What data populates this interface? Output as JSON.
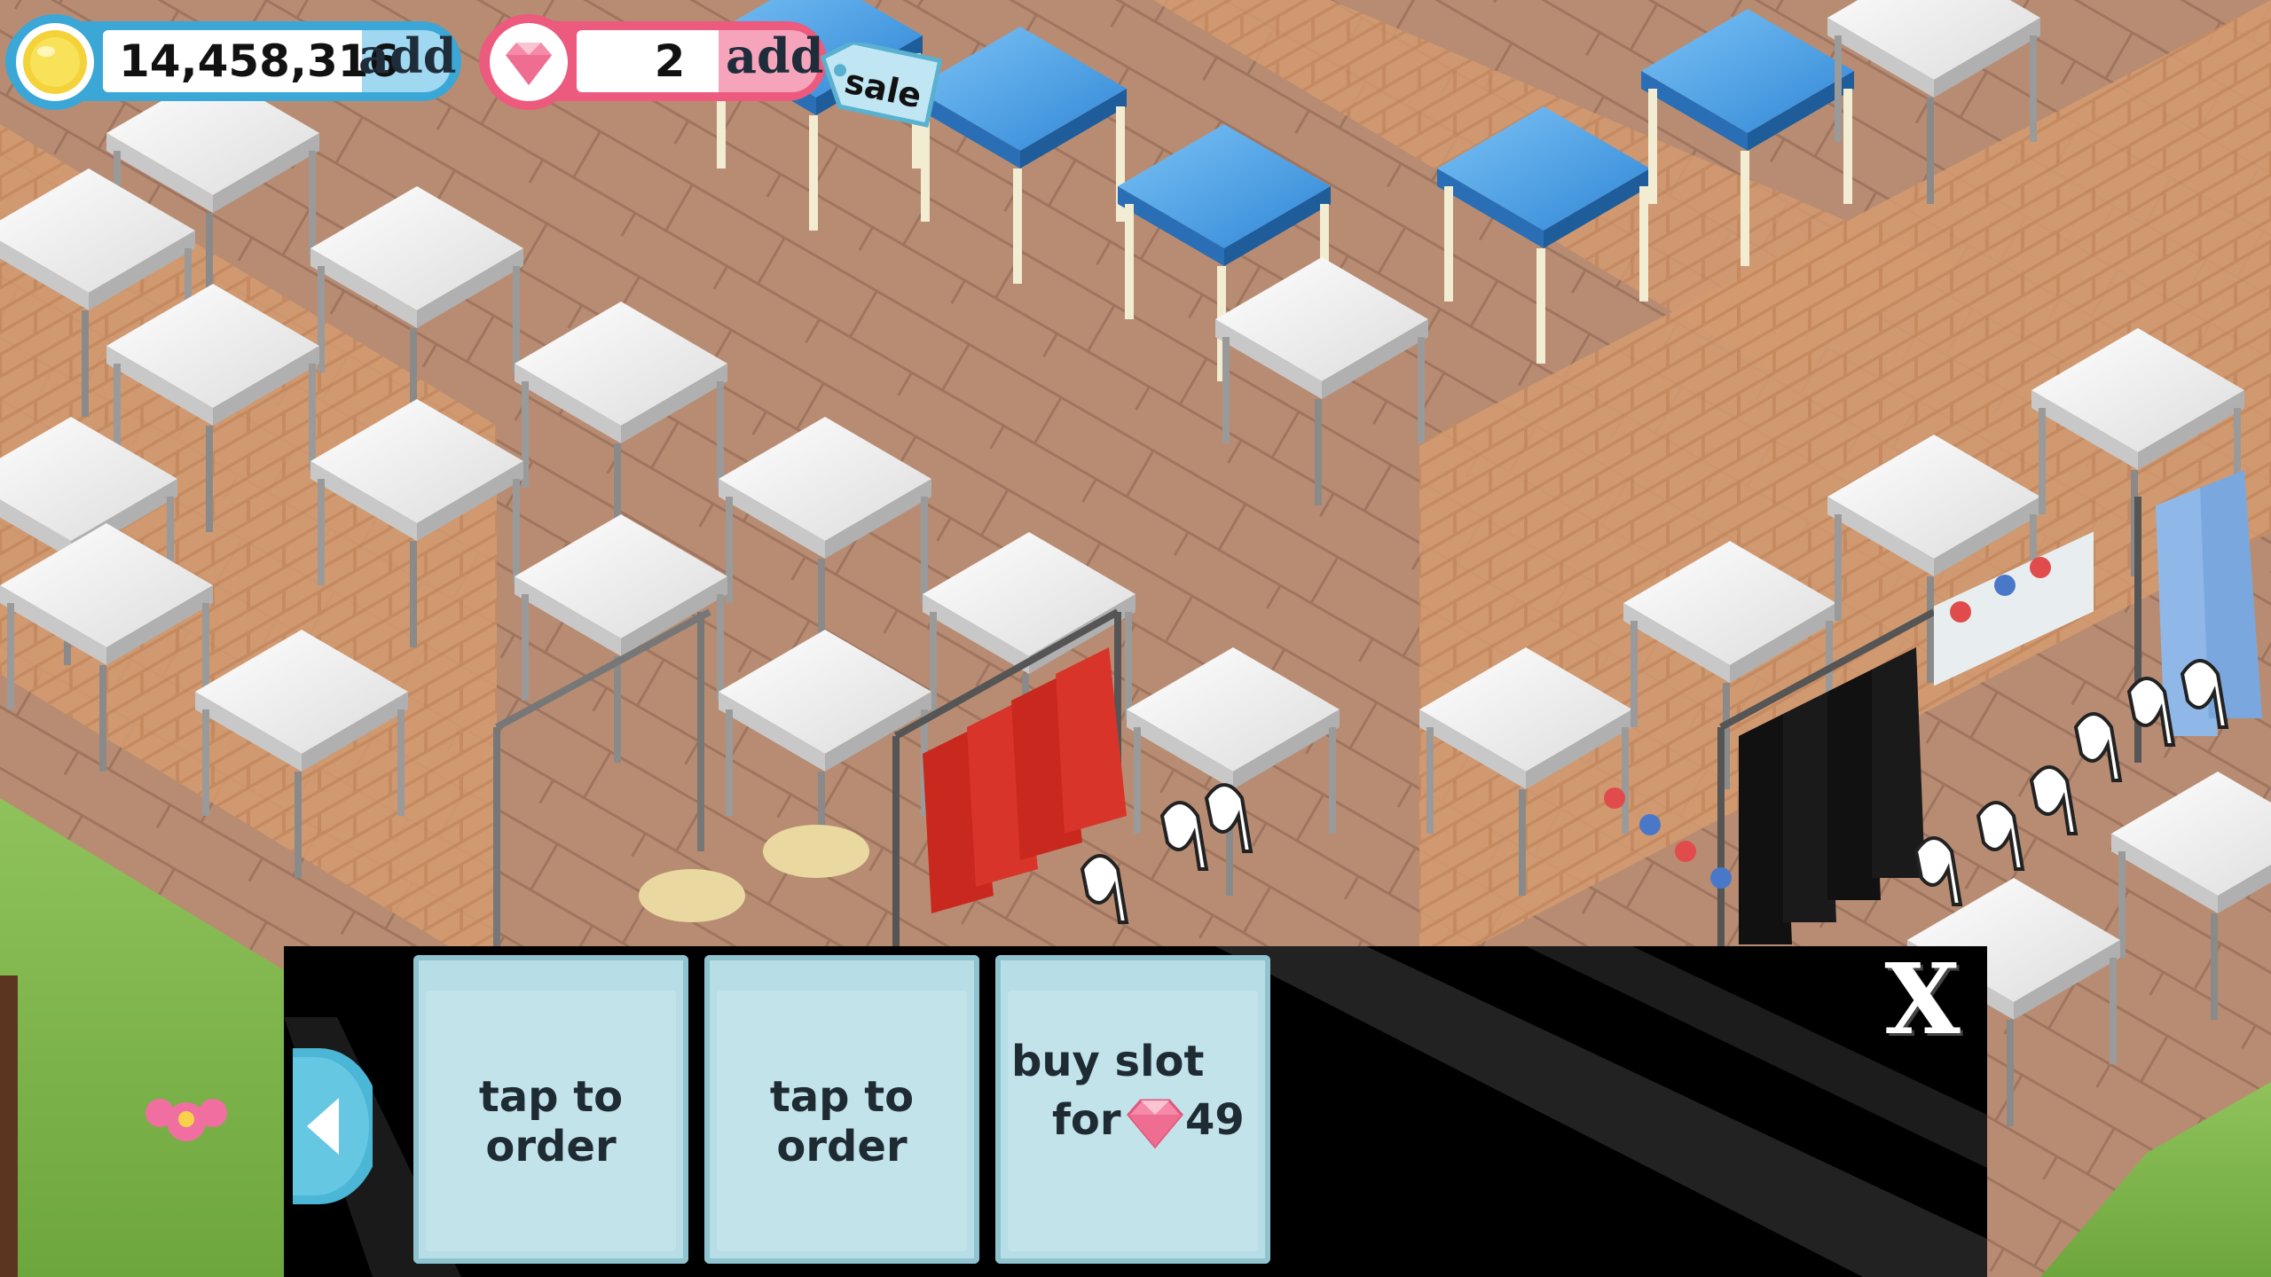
{
  "hud": {
    "coins": {
      "value": "14,458,316",
      "add_label": "add",
      "icon": "gold-coin-icon"
    },
    "gems": {
      "value": "2",
      "add_label": "add",
      "icon": "diamond-gem-icon"
    },
    "sale_tag": {
      "label": "sale"
    }
  },
  "order_panel": {
    "slots": [
      {
        "label": "tap to order"
      },
      {
        "label": "tap to order"
      },
      {
        "buy_text": "buy slot",
        "for_text": "for",
        "price": "49",
        "currency_icon": "diamond-gem-icon"
      }
    ],
    "close_label": "X",
    "prev_icon": "left-arrow-icon"
  },
  "colors": {
    "coin_accent": "#3aa7d6",
    "gem_accent": "#ec5a7e",
    "panel_bg": "#000000",
    "slot_bg": "#b7dde6"
  }
}
